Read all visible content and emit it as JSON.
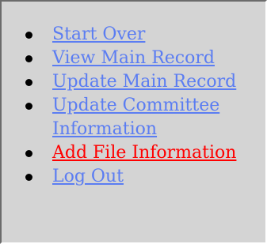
{
  "colors": {
    "link": "#5b7df2",
    "current": "#ff0000",
    "panel_bg": "#d4d4d4"
  },
  "nav": {
    "items": [
      {
        "label": "Start Over",
        "current": false
      },
      {
        "label": "View Main Record",
        "current": false
      },
      {
        "label": "Update Main Record",
        "current": false
      },
      {
        "label": "Update Committee Information",
        "current": false
      },
      {
        "label": "Add File Information",
        "current": true
      },
      {
        "label": "Log Out",
        "current": false
      }
    ]
  }
}
